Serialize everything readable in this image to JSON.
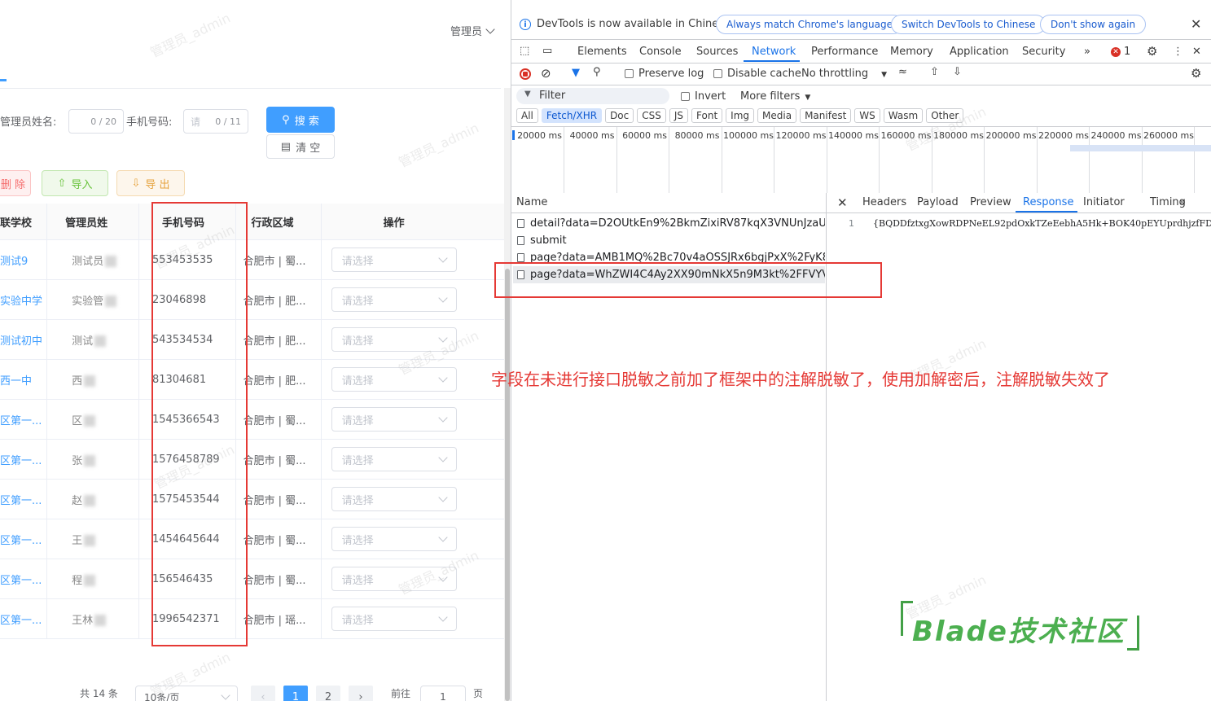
{
  "app": {
    "user": "管理员",
    "search": {
      "admin_name_label": "管理员姓名:",
      "admin_name_counter": "0 / 20",
      "phone_label": "手机号码:",
      "phone_placeholder": "请",
      "phone_counter": "0 / 11",
      "search_button": "搜 索",
      "clear_button": "清 空"
    },
    "toolbar": {
      "delete_button": "删 除",
      "import_button": "导入",
      "export_button": "导 出"
    },
    "table": {
      "headers": [
        "联学校",
        "管理员姓",
        "手机号码",
        "行政区域",
        "操作"
      ],
      "rows": [
        {
          "school": "测试9",
          "name": "测试员",
          "phone": "553453535",
          "region": "合肥市 | 蜀...",
          "op": "请选择"
        },
        {
          "school": "实验中学",
          "name": "实验管",
          "phone": "23046898",
          "region": "合肥市 | 肥...",
          "op": "请选择"
        },
        {
          "school": "测试初中",
          "name": "测试",
          "phone": "543534534",
          "region": "合肥市 | 肥...",
          "op": "请选择"
        },
        {
          "school": "西一中",
          "name": "西",
          "phone": "81304681",
          "region": "合肥市 | 肥...",
          "op": "请选择"
        },
        {
          "school": "区第一...",
          "name": "区",
          "phone": "1545366543",
          "region": "合肥市 | 蜀...",
          "op": "请选择"
        },
        {
          "school": "区第一...",
          "name": "张",
          "phone": "1576458789",
          "region": "合肥市 | 蜀...",
          "op": "请选择"
        },
        {
          "school": "区第一...",
          "name": "赵",
          "phone": "1575453544",
          "region": "合肥市 | 蜀...",
          "op": "请选择"
        },
        {
          "school": "区第一...",
          "name": "王",
          "phone": "1454645644",
          "region": "合肥市 | 蜀...",
          "op": "请选择"
        },
        {
          "school": "区第一...",
          "name": "程",
          "phone": "156546435",
          "region": "合肥市 | 蜀...",
          "op": "请选择"
        },
        {
          "school": "区第一...",
          "name": "王林",
          "phone": "1996542371",
          "region": "合肥市 | 瑶...",
          "op": "请选择"
        }
      ]
    },
    "pager": {
      "total": "共 14 条",
      "page_size": "10条/页",
      "pages": [
        "1",
        "2"
      ],
      "goto_label": "前往",
      "goto_value": "1",
      "page_unit": "页"
    },
    "watermark": "管理员_admin"
  },
  "devtools": {
    "info_bar": {
      "message": "DevTools is now available in Chinese!",
      "btn_match": "Always match Chrome's language",
      "btn_switch": "Switch DevTools to Chinese",
      "btn_dont_show": "Don't show again"
    },
    "tabs": [
      "Elements",
      "Console",
      "Sources",
      "Network",
      "Performance",
      "Memory",
      "Application",
      "Security"
    ],
    "error_count": "1",
    "toolbar": {
      "preserve_log": "Preserve log",
      "disable_cache": "Disable cache",
      "throttling": "No throttling"
    },
    "filter": {
      "placeholder": "Filter",
      "invert": "Invert",
      "more_filters": "More filters"
    },
    "type_chips": [
      "All",
      "Fetch/XHR",
      "Doc",
      "CSS",
      "JS",
      "Font",
      "Img",
      "Media",
      "Manifest",
      "WS",
      "Wasm",
      "Other"
    ],
    "timeline_ticks": [
      "20000 ms",
      "40000 ms",
      "60000 ms",
      "80000 ms",
      "100000 ms",
      "120000 ms",
      "140000 ms",
      "160000 ms",
      "180000 ms",
      "200000 ms",
      "220000 ms",
      "240000 ms",
      "260000 ms",
      "28"
    ],
    "name_header": "Name",
    "detail_tabs": [
      "Headers",
      "Payload",
      "Preview",
      "Response",
      "Initiator",
      "Timing"
    ],
    "requests": [
      "detail?data=D2OUtkEn9%2BkmZixiRV87kqX3VNUnJzaUCDr...",
      "submit",
      "page?data=AMB1MQ%2Bc70v4aOSSJRx6bgjPxX%2FyK8YnU...",
      "page?data=WhZWI4C4Ay2XX90mNkX5n9M3kt%2FFVYV4xO..."
    ],
    "response_line_no": "1",
    "response_body": "{BQDDfztxgXowRDPNeEL92pdOxkTZeEebhA5Hk+BOK40pEYUprdhjzfFD5iOWTSmtDRAa"
  },
  "annotation": "字段在未进行接口脱敏之前加了框架中的注解脱敏了，使用加解密后，注解脱敏失效了",
  "logo": "Blade技术社区",
  "colors": {
    "primary": "#409eff",
    "devtools_accent": "#1a73e8",
    "annotation_red": "#e53935",
    "logo_green": "#4caf50"
  }
}
